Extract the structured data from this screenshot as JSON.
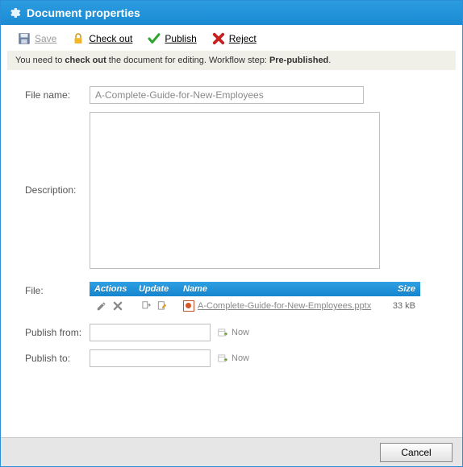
{
  "title": "Document properties",
  "toolbar": {
    "save": "Save",
    "checkout": "Check out",
    "publish": "Publish",
    "reject": "Reject"
  },
  "notice": {
    "pre": "You need to ",
    "bold1": "check out",
    "mid": " the document for editing. Workflow step: ",
    "bold2": "Pre-published",
    "post": "."
  },
  "labels": {
    "file_name": "File name:",
    "description": "Description:",
    "file": "File:",
    "publish_from": "Publish from:",
    "publish_to": "Publish to:",
    "now": "Now"
  },
  "fields": {
    "file_name": "A-Complete-Guide-for-New-Employees",
    "description": "",
    "publish_from": "",
    "publish_to": ""
  },
  "file_table": {
    "headers": {
      "actions": "Actions",
      "update": "Update",
      "name": "Name",
      "size": "Size"
    },
    "row": {
      "name": "A-Complete-Guide-for-New-Employees.pptx",
      "size": "33 kB"
    }
  },
  "footer": {
    "cancel": "Cancel"
  }
}
